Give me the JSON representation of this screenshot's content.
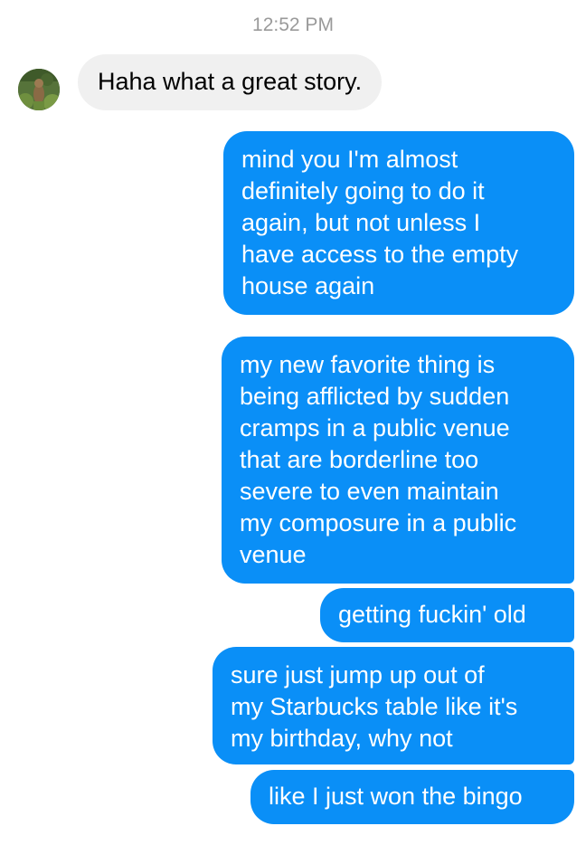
{
  "conversation": {
    "timestamp": "12:52 PM",
    "contact_avatar": "contact-avatar-photo",
    "messages": [
      {
        "direction": "received",
        "text": "Haha what a great story."
      },
      {
        "direction": "sent",
        "text": "mind you I'm almost\ndefinitely going to do it\nagain, but not unless I\nhave access to the empty\nhouse again"
      },
      {
        "direction": "sent",
        "text": "my new favorite thing is\nbeing afflicted by sudden\ncramps in a public venue\nthat are borderline too\nsevere to even maintain\nmy composure in a public\nvenue"
      },
      {
        "direction": "sent",
        "text": "getting fuckin' old"
      },
      {
        "direction": "sent",
        "text": "sure just jump up out of\nmy Starbucks table like it's\nmy birthday, why not"
      },
      {
        "direction": "sent",
        "text": "like I just won the bingo"
      }
    ]
  },
  "colors": {
    "sent_bubble": "#0a8ff7",
    "received_bubble": "#f0f0f0",
    "timestamp_text": "#9a9a9a"
  }
}
